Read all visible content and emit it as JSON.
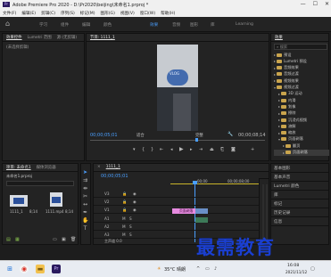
{
  "window": {
    "title": "Adobe Premiere Pro 2020 - D:\\Pr2020\\beijing\\未命名1.prproj *",
    "controls": [
      "—",
      "☐",
      "✕"
    ]
  },
  "menu": [
    "文件(F)",
    "编辑(E)",
    "剪辑(C)",
    "序列(S)",
    "标记(M)",
    "图形(G)",
    "视图(V)",
    "窗口(W)",
    "帮助(H)"
  ],
  "workspaces": {
    "tabs": [
      "学习",
      "组件",
      "编辑",
      "颜色",
      "效果",
      "音频",
      "图形",
      "库",
      "Learning"
    ],
    "active_index": 4
  },
  "source_panel": {
    "tabs": [
      "效果控件",
      "Lumetri 范围",
      "源:(无剪辑)",
      "音频"
    ],
    "message": "(未选择剪辑)"
  },
  "program_monitor": {
    "tab": "节目: 1111_1",
    "timecode_left": "00;00;05;01",
    "fit_label": "适合",
    "quality_label": "完整",
    "timecode_right": "00;00;08;14",
    "video_overlay": "VLOG"
  },
  "effects_panel": {
    "title": "效果",
    "search_placeholder": "搜索",
    "items": [
      {
        "label": "预设",
        "indent": 0,
        "open": false
      },
      {
        "label": "Lumetri 预设",
        "indent": 0,
        "open": false
      },
      {
        "label": "音频效果",
        "indent": 0,
        "open": false
      },
      {
        "label": "音频过渡",
        "indent": 0,
        "open": false
      },
      {
        "label": "视频效果",
        "indent": 0,
        "open": false
      },
      {
        "label": "视频过渡",
        "indent": 0,
        "open": true
      },
      {
        "label": "3D 运动",
        "indent": 1,
        "open": false
      },
      {
        "label": "内滑",
        "indent": 1,
        "open": false
      },
      {
        "label": "划像",
        "indent": 1,
        "open": false
      },
      {
        "label": "擦除",
        "indent": 1,
        "open": false
      },
      {
        "label": "沉浸式视频",
        "indent": 1,
        "open": false
      },
      {
        "label": "溶解",
        "indent": 1,
        "open": false
      },
      {
        "label": "缩放",
        "indent": 1,
        "open": false
      },
      {
        "label": "页面剥落",
        "indent": 1,
        "open": true
      },
      {
        "label": "翻页",
        "indent": 2,
        "open": false
      },
      {
        "label": "页面剥落",
        "indent": 2,
        "open": false
      }
    ],
    "selected_index": 15
  },
  "right_panels": [
    "基本图形",
    "基本声音",
    "Lumetri 颜色",
    "库",
    "标记",
    "历史记录",
    "信息"
  ],
  "project_panel": {
    "tabs": [
      "项目: 未命名1",
      "媒体浏览器",
      "库"
    ],
    "file": "未命名1.prproj",
    "items": [
      {
        "name": "1111_1",
        "duration": "8;14"
      },
      {
        "name": "1111.mp4",
        "duration": "8;14"
      }
    ]
  },
  "timeline": {
    "tab": "1111_1",
    "timecode": "00;00;05;01",
    "ruler": [
      "00;00",
      "00;00;08;00"
    ],
    "video_tracks": [
      "V3",
      "V2",
      "V1"
    ],
    "audio_tracks": [
      "A1",
      "A2",
      "A3"
    ],
    "master_label": "主声道",
    "master_value": "0.0",
    "clip_label": "页面剥落"
  },
  "taskbar": {
    "weather": "35°C 晴朗",
    "ime": "英",
    "time": "16:08",
    "date": "2021/11/12"
  },
  "watermark": "最需教育",
  "colors": {
    "accent_blue": "#4a9fff",
    "clip_pink": "#e78be0",
    "clip_blue": "#6a90c8",
    "watermark": "#1a3fd0"
  }
}
